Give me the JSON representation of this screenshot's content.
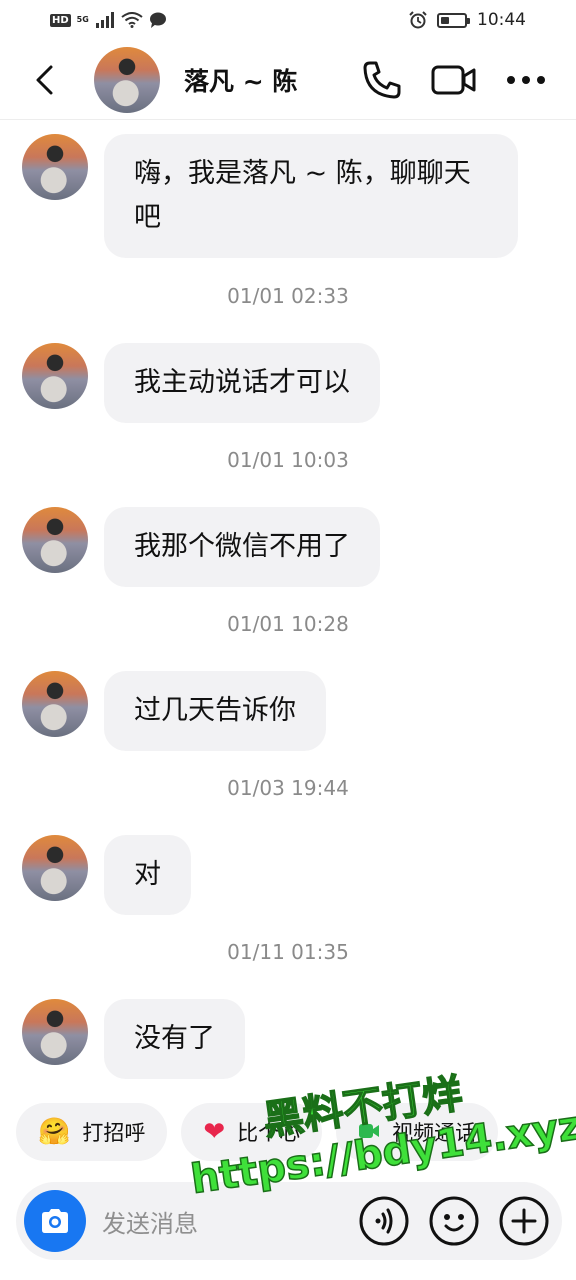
{
  "status_bar": {
    "hd": "HD",
    "network": "5G",
    "time": "10:44",
    "battery_level": 0.35
  },
  "header": {
    "contact_name": "落凡 ~ 陈"
  },
  "messages": [
    {
      "text": "嗨，我是落凡 ~ 陈，聊聊天吧"
    },
    {
      "timestamp": "01/01 02:33",
      "text": "我主动说话才可以"
    },
    {
      "timestamp": "01/01 10:03",
      "text": "我那个微信不用了"
    },
    {
      "timestamp": "01/01 10:28",
      "text": "过几天告诉你"
    },
    {
      "timestamp": "01/03 19:44",
      "text": "对"
    },
    {
      "timestamp": "01/11 01:35",
      "text": "没有了"
    }
  ],
  "quick_replies": [
    {
      "label": "打招呼",
      "icon": "wave-emoji-icon"
    },
    {
      "label": "比个心",
      "icon": "heart-icon"
    },
    {
      "label": "视频通话",
      "icon": "video-call-icon"
    }
  ],
  "input": {
    "placeholder": "发送消息"
  },
  "watermark": {
    "line1": "黑料不打烊",
    "line2": "https://bdy14.xyz"
  },
  "colors": {
    "accent": "#1877f2",
    "bubble": "#f2f2f4",
    "watermark": "#3fe03a"
  }
}
